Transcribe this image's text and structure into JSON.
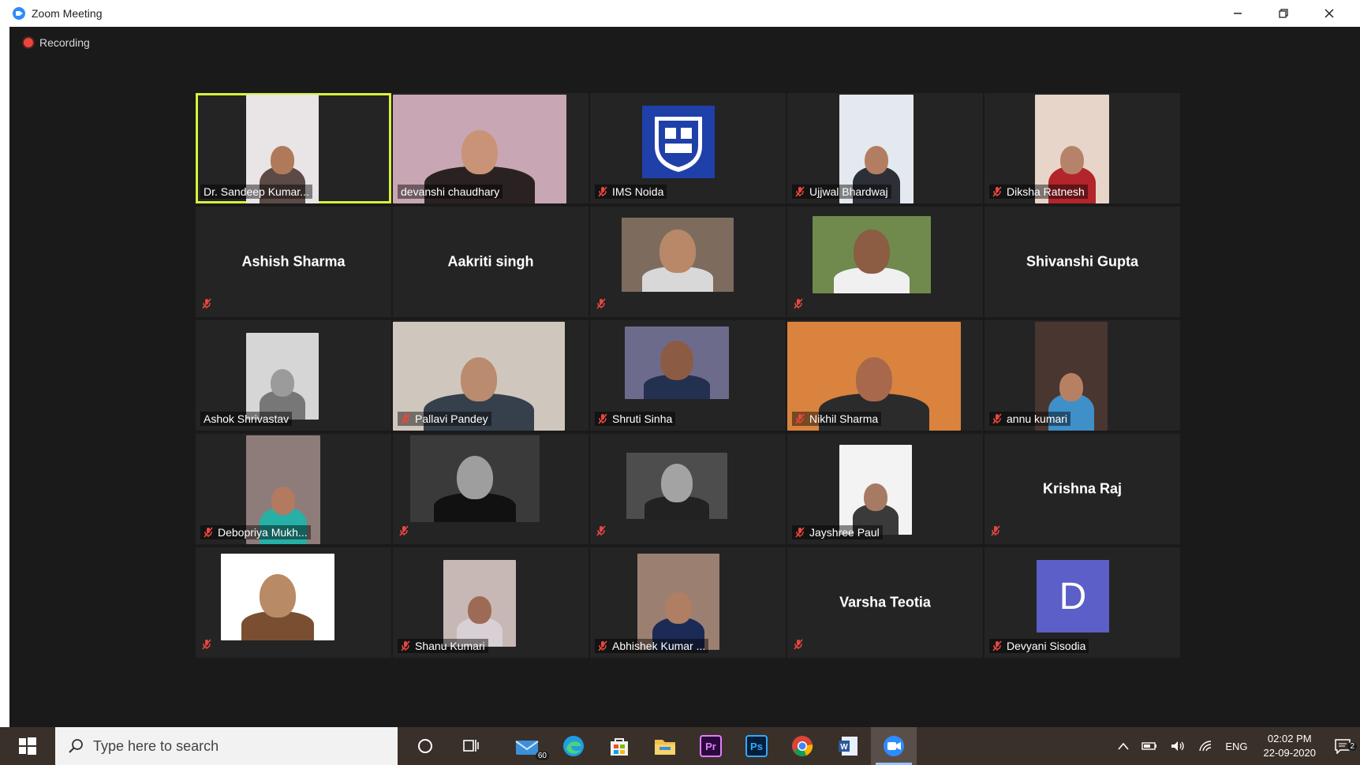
{
  "window": {
    "title": "Zoom Meeting",
    "controls": [
      "minimize",
      "restore",
      "close"
    ]
  },
  "meeting": {
    "recording_label": "Recording",
    "participants": [
      {
        "name": "Dr. Sandeep Kumar...",
        "video": "photo",
        "muted": false,
        "active_speaker": true
      },
      {
        "name": "devanshi chaudhary",
        "video": "photo",
        "muted": false
      },
      {
        "name": "IMS Noida",
        "video": "logo",
        "muted": true
      },
      {
        "name": "Ujjwal Bhardwaj",
        "video": "photo",
        "muted": true
      },
      {
        "name": "Diksha Ratnesh",
        "video": "photo",
        "muted": true
      },
      {
        "name": "Ashish Sharma",
        "video": "off",
        "muted": true
      },
      {
        "name": "Aakriti singh",
        "video": "off",
        "muted": false
      },
      {
        "name": "",
        "video": "photo",
        "muted": true
      },
      {
        "name": "",
        "video": "photo",
        "muted": true
      },
      {
        "name": "Shivanshi Gupta",
        "video": "off",
        "muted": false
      },
      {
        "name": "Ashok Shrivastav",
        "video": "photo",
        "muted": false
      },
      {
        "name": "Pallavi Pandey",
        "video": "photo",
        "muted": true
      },
      {
        "name": "Shruti Sinha",
        "video": "photo",
        "muted": true
      },
      {
        "name": "Nikhil Sharma",
        "video": "photo",
        "muted": true
      },
      {
        "name": "annu kumari",
        "video": "photo",
        "muted": true
      },
      {
        "name": "Debopriya Mukh...",
        "video": "photo",
        "muted": true
      },
      {
        "name": "",
        "video": "photo",
        "muted": true
      },
      {
        "name": "",
        "video": "photo",
        "muted": true
      },
      {
        "name": "Jayshree Paul",
        "video": "photo",
        "muted": true
      },
      {
        "name": "Krishna Raj",
        "video": "off",
        "muted": true
      },
      {
        "name": "",
        "video": "photo",
        "muted": true
      },
      {
        "name": "Shanu Kumari",
        "video": "photo",
        "muted": true
      },
      {
        "name": "Abhishek Kumar ...",
        "video": "photo",
        "muted": true
      },
      {
        "name": "Varsha Teotia",
        "video": "off",
        "muted": true
      },
      {
        "name": "Devyani Sisodia",
        "video": "avatar",
        "avatar_letter": "D",
        "muted": true
      }
    ]
  },
  "colors": {
    "active_speaker_border": "#d9f23a",
    "muted_icon": "#e8473e",
    "avatar_bg": "#5b5fc7",
    "zoom_blue": "#2d8cff"
  },
  "taskbar": {
    "search_placeholder": "Type here to search",
    "mail_badge": "60",
    "apps": [
      "cortana-icon",
      "task-view-icon",
      "mail-icon",
      "edge-icon",
      "store-icon",
      "file-explorer-icon",
      "premiere-icon",
      "photoshop-icon",
      "chrome-icon",
      "word-icon",
      "zoom-icon"
    ],
    "premiere_label": "Pr",
    "photoshop_label": "Ps",
    "language": "ENG",
    "time": "02:02 PM",
    "date": "22-09-2020",
    "notification_count": "2"
  }
}
